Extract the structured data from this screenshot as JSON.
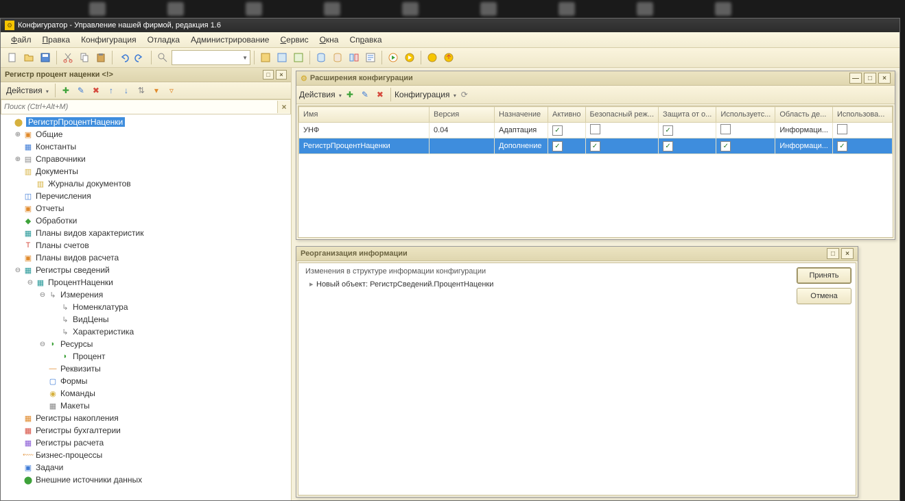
{
  "title": "Конфигуратор - Управление нашей фирмой, редакция 1.6",
  "menu": {
    "file": "Файл",
    "edit": "Правка",
    "config": "Конфигурация",
    "debug": "Отладка",
    "admin": "Администрирование",
    "service": "Сервис",
    "windows": "Окна",
    "help": "Справка"
  },
  "left_panel": {
    "title": "Регистр процент наценки <!>",
    "actions": "Действия",
    "search_placeholder": "Поиск (Ctrl+Alt+M)",
    "root": "РегистрПроцентНаценки",
    "nodes": {
      "common": "Общие",
      "constants": "Константы",
      "catalogs": "Справочники",
      "documents": "Документы",
      "doc_journals": "Журналы документов",
      "enums": "Перечисления",
      "reports": "Отчеты",
      "processings": "Обработки",
      "char_plans": "Планы видов характеристик",
      "acc_plans": "Планы счетов",
      "calc_plans": "Планы видов расчета",
      "info_reg": "Регистры сведений",
      "percent": "ПроцентНаценки",
      "dims": "Измерения",
      "nomen": "Номенклатура",
      "price_kind": "ВидЦены",
      "characteristic": "Характеристика",
      "resources": "Ресурсы",
      "percent_res": "Процент",
      "attrs": "Реквизиты",
      "forms": "Формы",
      "commands": "Команды",
      "templates": "Макеты",
      "accum_reg": "Регистры накопления",
      "acct_reg": "Регистры бухгалтерии",
      "calc_reg": "Регистры расчета",
      "bp": "Бизнес-процессы",
      "tasks": "Задачи",
      "ext_src": "Внешние источники данных"
    }
  },
  "ext_window": {
    "title": "Расширения конфигурации",
    "actions": "Действия",
    "config_menu": "Конфигурация",
    "cols": {
      "name": "Имя",
      "version": "Версия",
      "purpose": "Назначение",
      "active": "Активно",
      "safe": "Безопасный реж...",
      "protect": "Защита от о...",
      "used": "Используетс...",
      "scope": "Область де...",
      "used_in": "Использова..."
    },
    "rows": [
      {
        "name": "УНФ",
        "version": "0.04",
        "purpose": "Адаптация",
        "active": true,
        "safe": false,
        "protect": true,
        "used": false,
        "scope": "Информаци...",
        "used_in": false
      },
      {
        "name": "РегистрПроцентНаценки",
        "version": "",
        "purpose": "Дополнение",
        "active": true,
        "safe": true,
        "protect": true,
        "used": true,
        "scope": "Информаци...",
        "used_in": true
      }
    ]
  },
  "reorg": {
    "title": "Реорганизация информации",
    "desc": "Изменения в структуре информации конфигурации",
    "item": "Новый объект: РегистрСведений.ПроцентНаценки",
    "accept": "Принять",
    "cancel": "Отмена"
  }
}
